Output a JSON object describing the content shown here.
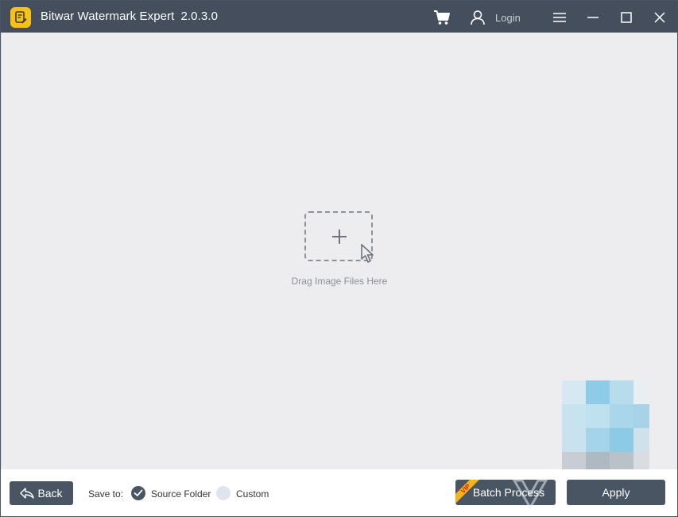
{
  "titlebar": {
    "app_name": "Bitwar Watermark Expert",
    "version": "2.0.3.0",
    "login_label": "Login",
    "icons": [
      "app-logo-icon",
      "cart-icon",
      "user-icon",
      "menu-icon",
      "minimize-icon",
      "maximize-icon",
      "close-icon"
    ]
  },
  "main": {
    "drop_label": "Drag Image Files Here",
    "icons": [
      "plus-icon",
      "pointer-cursor-icon"
    ]
  },
  "bottombar": {
    "back_label": "Back",
    "save_to_label": "Save to:",
    "options": [
      {
        "label": "Source Folder",
        "selected": true
      },
      {
        "label": "Custom",
        "selected": false
      }
    ],
    "batch_label": "Batch Process",
    "vip_label": "VIP",
    "apply_label": "Apply"
  },
  "colors": {
    "titlebar_bg": "#444e5c",
    "main_bg": "#ededf0",
    "button_bg": "#4a5563",
    "logo": "#f9c213"
  }
}
